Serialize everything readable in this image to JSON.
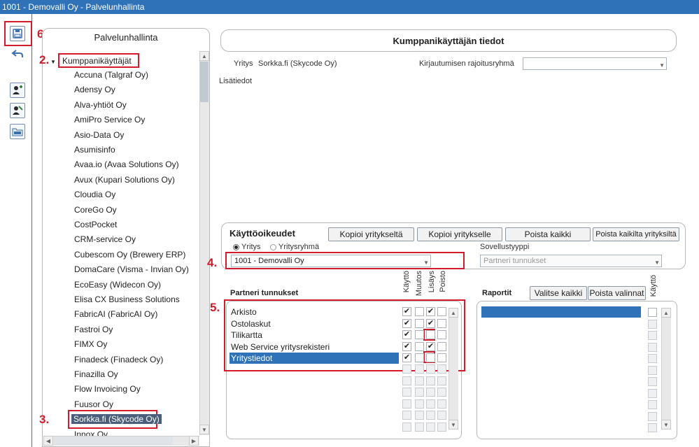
{
  "window": {
    "title": "1001 - Demovalli Oy - Palvelunhallinta"
  },
  "markers": {
    "m2": "2.",
    "m3": "3.",
    "m4": "4.",
    "m5": "5.",
    "m6": "6."
  },
  "left_panel": {
    "title": "Palvelunhallinta",
    "root": "Kumppanikäyttäjät",
    "items": [
      "Accuna (Talgraf Oy)",
      "Adensy Oy",
      "Alva-yhtiöt Oy",
      "AmiPro Service Oy",
      "Asio-Data Oy",
      "Asumisinfo",
      "Avaa.io (Avaa Solutions Oy)",
      "Avux (Kupari Solutions Oy)",
      "Cloudia Oy",
      "CoreGo Oy",
      "CostPocket",
      "CRM-service Oy",
      "Cubescom Oy (Brewery ERP)",
      "DomaCare (Visma - Invian Oy)",
      "EcoEasy (Widecon Oy)",
      "Elisa CX Business Solutions",
      "FabricAI (FabricAI Oy)",
      "Fastroi Oy",
      "FIMX Oy",
      "Finadeck (Finadeck Oy)",
      "Finazilla Oy",
      "Flow Invoicing Oy",
      "Fuusor Oy",
      "Sorkka.fi (Skycode Oy)",
      "Innox Oy"
    ],
    "selected_index": 23
  },
  "main": {
    "title": "Kumppanikäyttäjän tiedot",
    "company_label": "Yritys",
    "company_value": "Sorkka.fi (Skycode Oy)",
    "login_group_label": "Kirjautumisen rajoitusryhmä",
    "login_group_value": "",
    "extra_label": "Lisätiedot"
  },
  "rights": {
    "title": "Käyttöoikeudet",
    "buttons": [
      "Kopioi yritykseltä",
      "Kopioi yritykselle",
      "Poista kaikki",
      "Poista kaikilta yrityksiltä"
    ],
    "radio_company": "Yritys",
    "radio_group": "Yritysryhmä",
    "company_select": "1001 - Demovalli Oy",
    "app_type_label": "Sovellustyyppi",
    "app_type_value": "Partneri tunnukset"
  },
  "partners": {
    "title": "Partneri tunnukset",
    "columns": [
      "Käyttö",
      "Muutos",
      "Lisäys",
      "Poisto"
    ],
    "rows": [
      {
        "name": "Arkisto",
        "checks": [
          "✔",
          "",
          "✔",
          ""
        ]
      },
      {
        "name": "Ostolaskut",
        "checks": [
          "✔",
          "",
          "✔",
          ""
        ]
      },
      {
        "name": "Tilikartta",
        "checks": [
          "✔",
          "",
          "",
          ""
        ]
      },
      {
        "name": "Web Service yritysrekisteri",
        "checks": [
          "✔",
          "",
          "✔",
          ""
        ]
      },
      {
        "name": "Yritystiedot",
        "checks": [
          "✔",
          "",
          "",
          ""
        ]
      }
    ],
    "selected_index": 4
  },
  "reports": {
    "title": "Raportit",
    "select_all": "Valitse kaikki",
    "clear": "Poista valinnat",
    "column": "Käyttö"
  },
  "colors": {
    "accent": "#2f72b8",
    "highlight": "#d21c2b"
  }
}
